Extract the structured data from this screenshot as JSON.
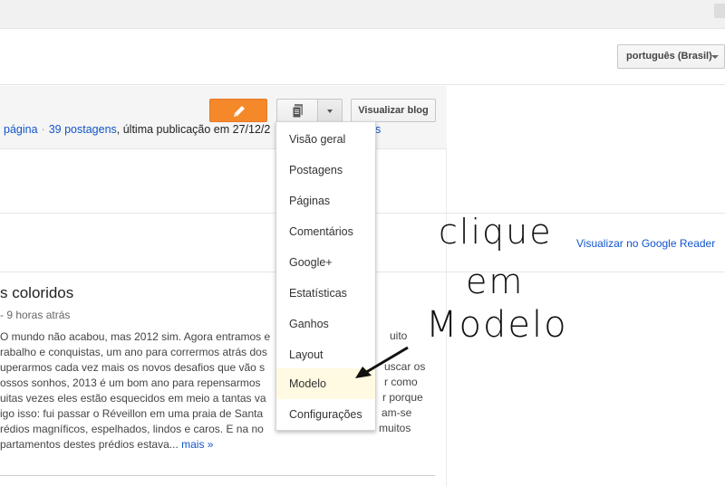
{
  "language": {
    "selected": "português (Brasil)"
  },
  "toolbar": {
    "view_blog_label": "Visualizar blog"
  },
  "stats": {
    "page_link": "página",
    "posts_link": "39 postagens",
    "last_published": ", última publicação em 27/12/2",
    "tail_link": "s"
  },
  "dropdown": {
    "items": [
      "Visão geral",
      "Postagens",
      "Páginas",
      "Comentários",
      "Google+",
      "Estatísticas",
      "Ganhos",
      "Layout",
      "Modelo",
      "Configurações"
    ],
    "highlighted": "Modelo"
  },
  "reader": {
    "link": "Visualizar no Google Reader"
  },
  "post": {
    "title": "s coloridos",
    "meta": "- 9 horas atrás",
    "lines": [
      "O mundo não acabou, mas 2012 sim. Agora entramos e",
      "rabalho e conquistas, um ano para corrermos atrás dos",
      "uperarmos cada vez mais os novos desafios que vão s",
      "ossos sonhos, 2013 é um bom ano para repensarmos",
      "uitas vezes eles estão esquecidos em meio a tantas va",
      "igo isso: fui passar o Réveillon em uma praia de Santa",
      "rédios magníficos, espelhados, lindos e caros. E na no",
      "partamentos destes prédios estava..."
    ],
    "right_fragments": [
      "uito",
      "uscar os",
      "r como",
      "r porque",
      "am-se",
      "muitos"
    ],
    "more_link": "mais »"
  },
  "annotation": {
    "line1": "clique",
    "line2": "em",
    "line3": "Modelo"
  },
  "colors": {
    "accent_orange": "#f5892a",
    "link_blue": "#1155cc",
    "menu_highlight": "#fffae1"
  }
}
